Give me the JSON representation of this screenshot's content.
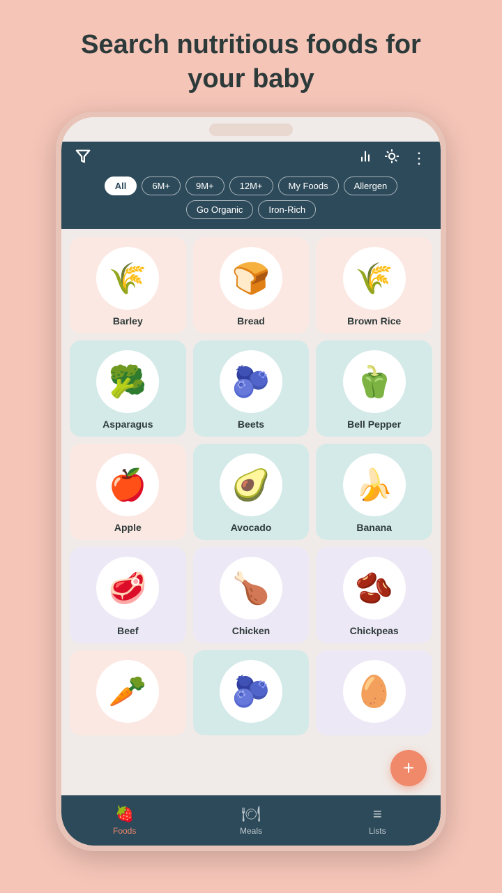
{
  "page": {
    "title_line1": "Search nutritious foods for",
    "title_line2": "your baby"
  },
  "header": {
    "filter_tabs": [
      {
        "id": "all",
        "label": "All",
        "active": true
      },
      {
        "id": "6m",
        "label": "6M+",
        "active": false
      },
      {
        "id": "9m",
        "label": "9M+",
        "active": false
      },
      {
        "id": "12m",
        "label": "12M+",
        "active": false
      },
      {
        "id": "myfoods",
        "label": "My Foods",
        "active": false
      },
      {
        "id": "allergen",
        "label": "Allergen",
        "active": false
      },
      {
        "id": "organic",
        "label": "Go Organic",
        "active": false
      },
      {
        "id": "iron",
        "label": "Iron-Rich",
        "active": false
      }
    ]
  },
  "foods": [
    {
      "name": "Barley",
      "emoji": "🌾",
      "color": "pink"
    },
    {
      "name": "Bread",
      "emoji": "🍞",
      "color": "pink"
    },
    {
      "name": "Brown Rice",
      "emoji": "🌾",
      "color": "pink"
    },
    {
      "name": "Asparagus",
      "emoji": "🥦",
      "color": "teal"
    },
    {
      "name": "Beets",
      "emoji": "🫐",
      "color": "teal"
    },
    {
      "name": "Bell Pepper",
      "emoji": "🫑",
      "color": "teal"
    },
    {
      "name": "Apple",
      "emoji": "🍎",
      "color": "pink"
    },
    {
      "name": "Avocado",
      "emoji": "🥑",
      "color": "teal"
    },
    {
      "name": "Banana",
      "emoji": "🍌",
      "color": "teal"
    },
    {
      "name": "Beef",
      "emoji": "🥩",
      "color": "lavender"
    },
    {
      "name": "Chicken",
      "emoji": "🍗",
      "color": "lavender"
    },
    {
      "name": "Chickpeas",
      "emoji": "🫘",
      "color": "lavender"
    },
    {
      "name": "",
      "emoji": "🥕",
      "color": "pink"
    },
    {
      "name": "",
      "emoji": "🫐",
      "color": "teal"
    },
    {
      "name": "",
      "emoji": "🥚",
      "color": "lavender"
    }
  ],
  "bottom_nav": [
    {
      "id": "foods",
      "label": "Foods",
      "icon": "🍓",
      "active": true
    },
    {
      "id": "meals",
      "label": "Meals",
      "icon": "🍽",
      "active": false
    },
    {
      "id": "lists",
      "label": "Lists",
      "icon": "📋",
      "active": false
    }
  ],
  "fab": {
    "icon": "+"
  },
  "icons": {
    "filter": "⊺",
    "bar_chart": "📊",
    "bulb": "💡",
    "more": "⋮"
  }
}
